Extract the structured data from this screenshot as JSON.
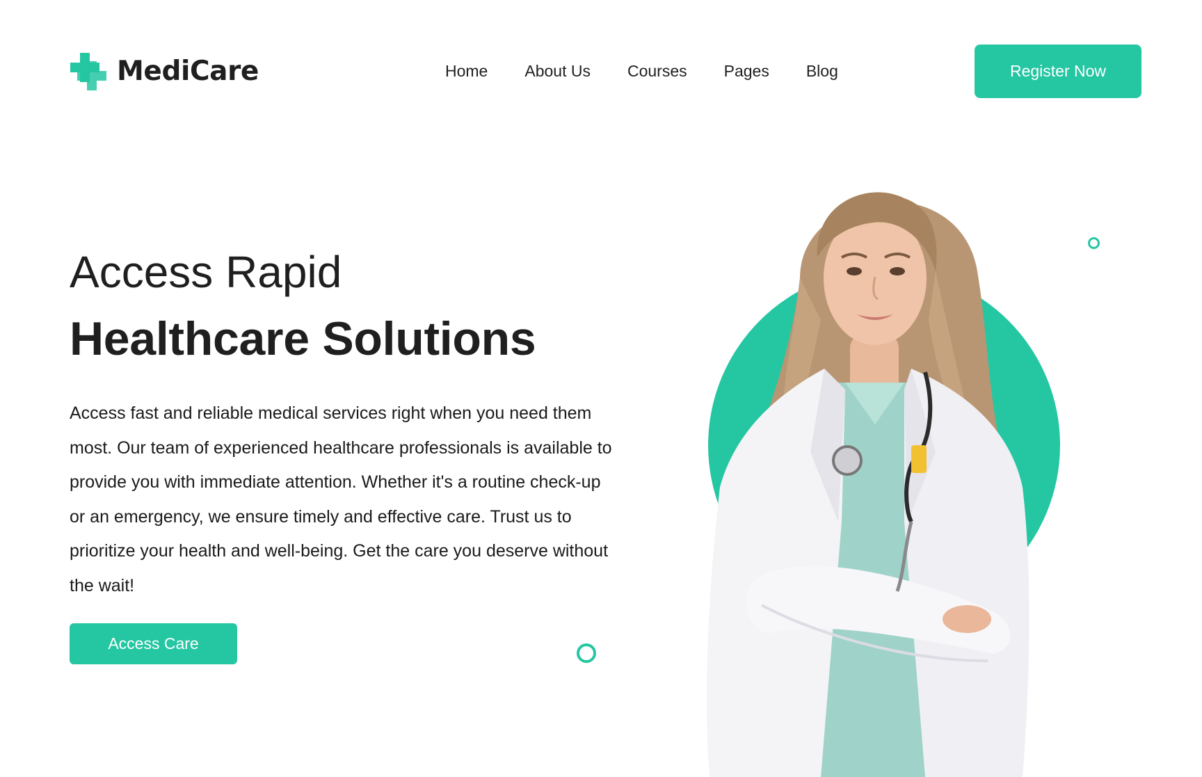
{
  "brand": {
    "name": "MediCare",
    "icon": "medical-cross-icon",
    "color": "#25c6a2"
  },
  "nav": {
    "items": [
      {
        "label": "Home"
      },
      {
        "label": "About Us"
      },
      {
        "label": "Courses"
      },
      {
        "label": "Pages"
      },
      {
        "label": "Blog"
      }
    ]
  },
  "header": {
    "register_label": "Register Now"
  },
  "hero": {
    "title_line1": "Access Rapid",
    "title_line2": "Healthcare Solutions",
    "description": "Access fast and reliable medical services right when you need them most. Our team of experienced healthcare professionals is available to provide you with immediate attention. Whether it's a routine check-up or an emergency, we ensure timely and effective care. Trust us to prioritize your health and well-being. Get the care you deserve without the wait!",
    "cta_label": "Access Care",
    "image": "female-doctor-with-stethoscope"
  },
  "colors": {
    "accent": "#25c6a2",
    "text": "#1f1f1f",
    "background": "#ffffff"
  }
}
